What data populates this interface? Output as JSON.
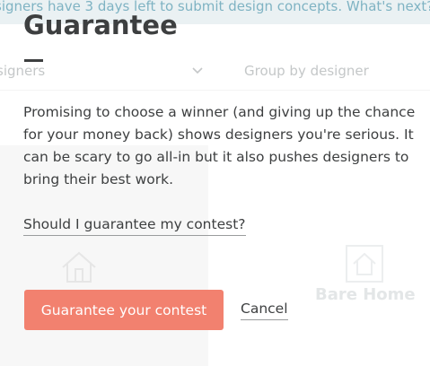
{
  "background": {
    "banner_text": "signers have 3 days left to submit design concepts. What's next?",
    "filter_left_label": "signers",
    "filter_right_label": "Group by designer",
    "right_card_title": "Bare Home"
  },
  "modal": {
    "title": "Guarantee",
    "body": "Promising to choose a winner (and giving up the chance for your money back) shows designers you're serious. It can be scary to go all-in but it also pushes designers to bring their best work.",
    "help_link": "Should I guarantee my contest?",
    "primary_button": "Guarantee your contest",
    "cancel_link": "Cancel"
  },
  "colors": {
    "accent": "#f2816f",
    "text": "#3d3f40",
    "banner_bg": "#eaf1f3",
    "banner_text": "#7fb3c3"
  },
  "icons": {
    "filter_chevron": "chevron-down-icon",
    "house": "house-icon"
  }
}
